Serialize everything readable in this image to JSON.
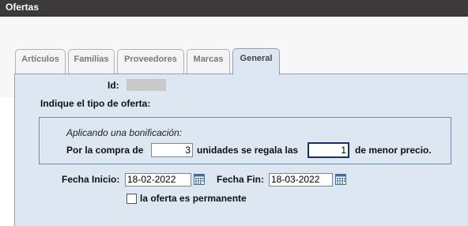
{
  "window": {
    "title": "Ofertas"
  },
  "tabs": [
    {
      "label": "Artículos",
      "active": false
    },
    {
      "label": "Familias",
      "active": false
    },
    {
      "label": "Proveedores",
      "active": false
    },
    {
      "label": "Marcas",
      "active": false
    },
    {
      "label": "General",
      "active": true
    }
  ],
  "form": {
    "id_label": "Id:",
    "id_value": "",
    "offer_type_label": "Indique el tipo de oferta:",
    "bonus": {
      "heading": "Aplicando una bonificación:",
      "prefix": "Por la compra de",
      "buy_quantity": "3",
      "middle": "unidades se regala las",
      "free_quantity": "1",
      "suffix": "de menor precio."
    },
    "start_date_label": "Fecha Inicio:",
    "start_date": "18-02-2022",
    "end_date_label": "Fecha Fin:",
    "end_date": "18-03-2022",
    "permanent_label": "la oferta es permanente",
    "permanent_checked": false
  },
  "icons": {
    "calendar": "calendar-icon"
  },
  "colors": {
    "titlebar": "#3c3a3b",
    "panel": "#dde7f1",
    "border": "#8fa1b6",
    "focus_border": "#1b2f63"
  }
}
